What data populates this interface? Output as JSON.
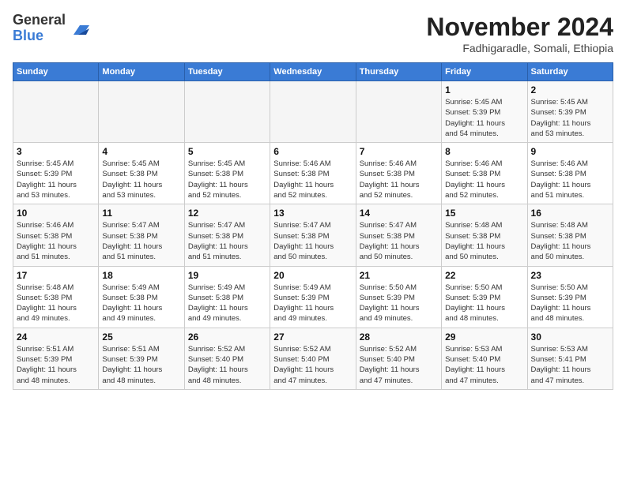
{
  "header": {
    "logo_line1": "General",
    "logo_line2": "Blue",
    "month_title": "November 2024",
    "subtitle": "Fadhigaradle, Somali, Ethiopia"
  },
  "calendar": {
    "days_of_week": [
      "Sunday",
      "Monday",
      "Tuesday",
      "Wednesday",
      "Thursday",
      "Friday",
      "Saturday"
    ],
    "weeks": [
      [
        {
          "day": "",
          "info": ""
        },
        {
          "day": "",
          "info": ""
        },
        {
          "day": "",
          "info": ""
        },
        {
          "day": "",
          "info": ""
        },
        {
          "day": "",
          "info": ""
        },
        {
          "day": "1",
          "info": "Sunrise: 5:45 AM\nSunset: 5:39 PM\nDaylight: 11 hours\nand 54 minutes."
        },
        {
          "day": "2",
          "info": "Sunrise: 5:45 AM\nSunset: 5:39 PM\nDaylight: 11 hours\nand 53 minutes."
        }
      ],
      [
        {
          "day": "3",
          "info": "Sunrise: 5:45 AM\nSunset: 5:39 PM\nDaylight: 11 hours\nand 53 minutes."
        },
        {
          "day": "4",
          "info": "Sunrise: 5:45 AM\nSunset: 5:38 PM\nDaylight: 11 hours\nand 53 minutes."
        },
        {
          "day": "5",
          "info": "Sunrise: 5:45 AM\nSunset: 5:38 PM\nDaylight: 11 hours\nand 52 minutes."
        },
        {
          "day": "6",
          "info": "Sunrise: 5:46 AM\nSunset: 5:38 PM\nDaylight: 11 hours\nand 52 minutes."
        },
        {
          "day": "7",
          "info": "Sunrise: 5:46 AM\nSunset: 5:38 PM\nDaylight: 11 hours\nand 52 minutes."
        },
        {
          "day": "8",
          "info": "Sunrise: 5:46 AM\nSunset: 5:38 PM\nDaylight: 11 hours\nand 52 minutes."
        },
        {
          "day": "9",
          "info": "Sunrise: 5:46 AM\nSunset: 5:38 PM\nDaylight: 11 hours\nand 51 minutes."
        }
      ],
      [
        {
          "day": "10",
          "info": "Sunrise: 5:46 AM\nSunset: 5:38 PM\nDaylight: 11 hours\nand 51 minutes."
        },
        {
          "day": "11",
          "info": "Sunrise: 5:47 AM\nSunset: 5:38 PM\nDaylight: 11 hours\nand 51 minutes."
        },
        {
          "day": "12",
          "info": "Sunrise: 5:47 AM\nSunset: 5:38 PM\nDaylight: 11 hours\nand 51 minutes."
        },
        {
          "day": "13",
          "info": "Sunrise: 5:47 AM\nSunset: 5:38 PM\nDaylight: 11 hours\nand 50 minutes."
        },
        {
          "day": "14",
          "info": "Sunrise: 5:47 AM\nSunset: 5:38 PM\nDaylight: 11 hours\nand 50 minutes."
        },
        {
          "day": "15",
          "info": "Sunrise: 5:48 AM\nSunset: 5:38 PM\nDaylight: 11 hours\nand 50 minutes."
        },
        {
          "day": "16",
          "info": "Sunrise: 5:48 AM\nSunset: 5:38 PM\nDaylight: 11 hours\nand 50 minutes."
        }
      ],
      [
        {
          "day": "17",
          "info": "Sunrise: 5:48 AM\nSunset: 5:38 PM\nDaylight: 11 hours\nand 49 minutes."
        },
        {
          "day": "18",
          "info": "Sunrise: 5:49 AM\nSunset: 5:38 PM\nDaylight: 11 hours\nand 49 minutes."
        },
        {
          "day": "19",
          "info": "Sunrise: 5:49 AM\nSunset: 5:38 PM\nDaylight: 11 hours\nand 49 minutes."
        },
        {
          "day": "20",
          "info": "Sunrise: 5:49 AM\nSunset: 5:39 PM\nDaylight: 11 hours\nand 49 minutes."
        },
        {
          "day": "21",
          "info": "Sunrise: 5:50 AM\nSunset: 5:39 PM\nDaylight: 11 hours\nand 49 minutes."
        },
        {
          "day": "22",
          "info": "Sunrise: 5:50 AM\nSunset: 5:39 PM\nDaylight: 11 hours\nand 48 minutes."
        },
        {
          "day": "23",
          "info": "Sunrise: 5:50 AM\nSunset: 5:39 PM\nDaylight: 11 hours\nand 48 minutes."
        }
      ],
      [
        {
          "day": "24",
          "info": "Sunrise: 5:51 AM\nSunset: 5:39 PM\nDaylight: 11 hours\nand 48 minutes."
        },
        {
          "day": "25",
          "info": "Sunrise: 5:51 AM\nSunset: 5:39 PM\nDaylight: 11 hours\nand 48 minutes."
        },
        {
          "day": "26",
          "info": "Sunrise: 5:52 AM\nSunset: 5:40 PM\nDaylight: 11 hours\nand 48 minutes."
        },
        {
          "day": "27",
          "info": "Sunrise: 5:52 AM\nSunset: 5:40 PM\nDaylight: 11 hours\nand 47 minutes."
        },
        {
          "day": "28",
          "info": "Sunrise: 5:52 AM\nSunset: 5:40 PM\nDaylight: 11 hours\nand 47 minutes."
        },
        {
          "day": "29",
          "info": "Sunrise: 5:53 AM\nSunset: 5:40 PM\nDaylight: 11 hours\nand 47 minutes."
        },
        {
          "day": "30",
          "info": "Sunrise: 5:53 AM\nSunset: 5:41 PM\nDaylight: 11 hours\nand 47 minutes."
        }
      ]
    ]
  }
}
